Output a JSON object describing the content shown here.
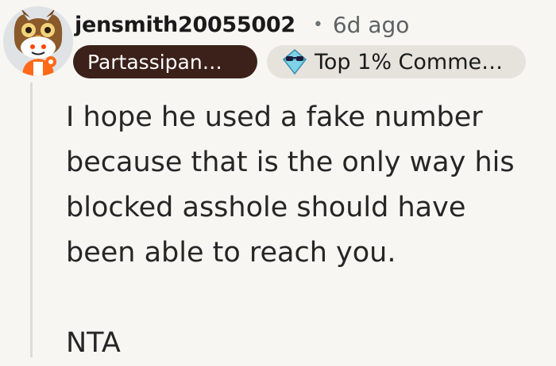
{
  "comment": {
    "username": "jensmith20055002",
    "separator": "•",
    "timestamp": "6d ago",
    "flairs": {
      "user_flair": "Partassipan…",
      "top_commenter": "Top 1% Comme…"
    },
    "body": [
      "I hope he used a fake number because that is the only way his blocked asshole should have been able to reach you.",
      "NTA"
    ]
  },
  "icons": {
    "avatar": "avatar-snoo-owl-costume",
    "top_commenter": "sunglasses-diamond-icon"
  },
  "colors": {
    "background": "#f7f6f2",
    "user_flair_bg": "#3b211a",
    "top_flair_bg": "#e6e3dd",
    "thread_line": "#dcdcd8"
  }
}
